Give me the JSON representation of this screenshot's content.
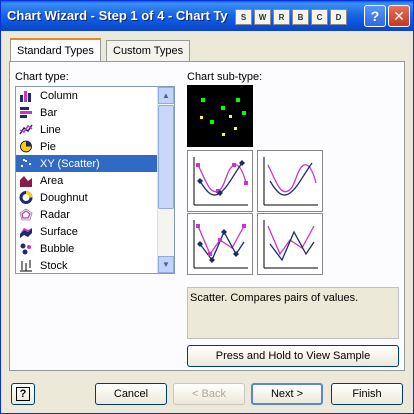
{
  "window": {
    "title": "Chart Wizard - Step 1 of 4 - Chart Ty",
    "toolbar_letters": [
      "S",
      "W",
      "R",
      "B",
      "C",
      "D"
    ],
    "help_glyph": "?",
    "close_glyph": "✕"
  },
  "tabs": [
    {
      "label": "Standard Types",
      "active": true
    },
    {
      "label": "Custom Types",
      "active": false
    }
  ],
  "chart_type": {
    "label": "Chart type:",
    "items": [
      {
        "label": "Column",
        "icon": "column-chart-icon"
      },
      {
        "label": "Bar",
        "icon": "bar-chart-icon"
      },
      {
        "label": "Line",
        "icon": "line-chart-icon"
      },
      {
        "label": "Pie",
        "icon": "pie-chart-icon"
      },
      {
        "label": "XY (Scatter)",
        "icon": "scatter-chart-icon",
        "selected": true
      },
      {
        "label": "Area",
        "icon": "area-chart-icon"
      },
      {
        "label": "Doughnut",
        "icon": "doughnut-chart-icon"
      },
      {
        "label": "Radar",
        "icon": "radar-chart-icon"
      },
      {
        "label": "Surface",
        "icon": "surface-chart-icon"
      },
      {
        "label": "Bubble",
        "icon": "bubble-chart-icon"
      },
      {
        "label": "Stock",
        "icon": "stock-chart-icon"
      }
    ]
  },
  "sub_type": {
    "label": "Chart sub-type:",
    "description": "Scatter. Compares pairs of values."
  },
  "buttons": {
    "preview": "Press and Hold to View Sample",
    "help_glyph": "?",
    "cancel": "Cancel",
    "back": "< Back",
    "next": "Next >",
    "finish": "Finish"
  },
  "colors": {
    "selection": "#316ac5",
    "scatter_point_green": "#00ff00",
    "scatter_point_yellow": "#ffff00",
    "series_magenta": "#cc33cc",
    "series_navy": "#1c2a6e"
  }
}
